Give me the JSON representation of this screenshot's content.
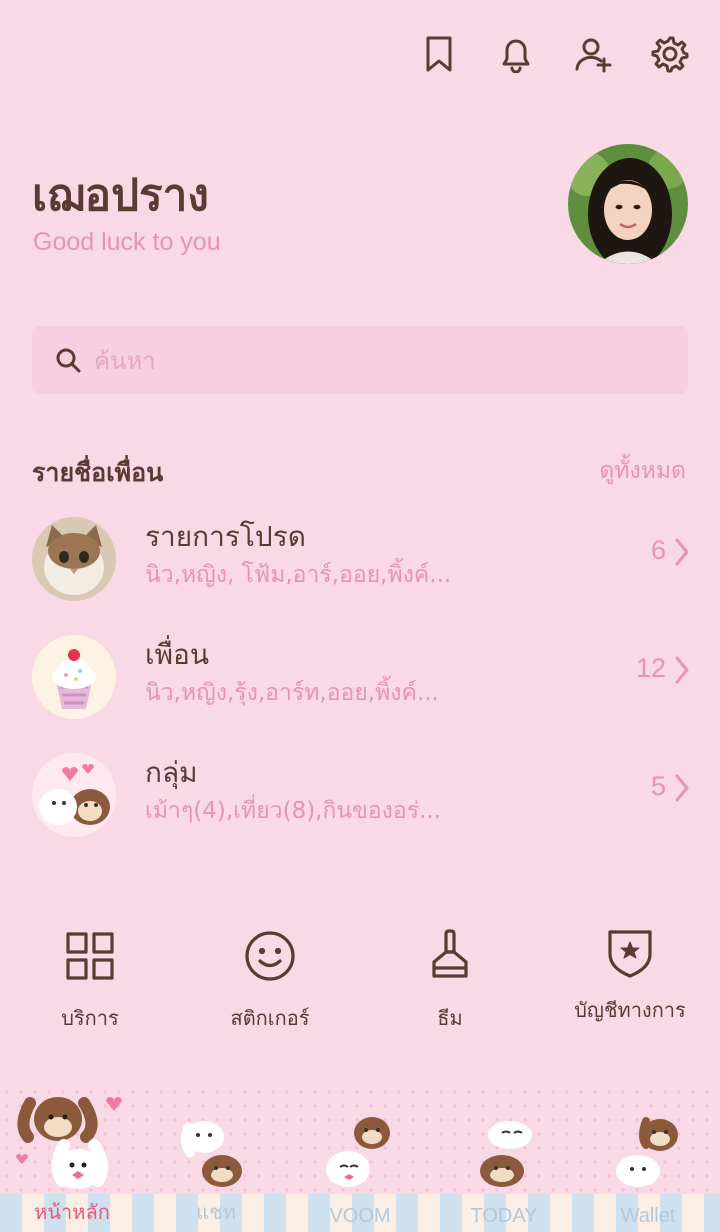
{
  "topbar": {
    "icons": [
      "bookmark-icon",
      "bell-icon",
      "add-friend-icon",
      "gear-icon"
    ]
  },
  "profile": {
    "name": "เฌอปราง",
    "status": "Good luck to you"
  },
  "search": {
    "placeholder": "ค้นหา"
  },
  "friends_section": {
    "title": "รายชื่อเพื่อน",
    "see_all": "ดูทั้งหมด"
  },
  "lists": [
    {
      "title": "รายการโปรด",
      "subtitle": "นิว,หญิง, โฟ้ม,อาร์,ออย,พิ้งค์...",
      "count": "6"
    },
    {
      "title": "เพื่อน",
      "subtitle": "นิว,หญิง,รุ้ง,อาร์ท,ออย,พิ้งค์...",
      "count": "12"
    },
    {
      "title": "กลุ่ม",
      "subtitle": "เม้าๆ(4),เที่ยว(8),กินของอร่...",
      "count": "5"
    }
  ],
  "shortcuts": [
    {
      "label": "บริการ",
      "icon": "grid-icon"
    },
    {
      "label": "สติกเกอร์",
      "icon": "smiley-icon"
    },
    {
      "label": "ธีม",
      "icon": "brush-icon"
    },
    {
      "label": "บัญชีทางการ",
      "icon": "shield-star-icon"
    }
  ],
  "tabs": [
    {
      "label": "หน้าหลัก",
      "active": true
    },
    {
      "label": "แชท",
      "active": false
    },
    {
      "label": "VOOM",
      "active": false
    },
    {
      "label": "TODAY",
      "active": false
    },
    {
      "label": "Wallet",
      "active": false
    }
  ],
  "colors": {
    "background": "#f9d9e6",
    "text": "#5b3a33",
    "accent": "#e694b2",
    "active_tab": "#e85a7d"
  }
}
